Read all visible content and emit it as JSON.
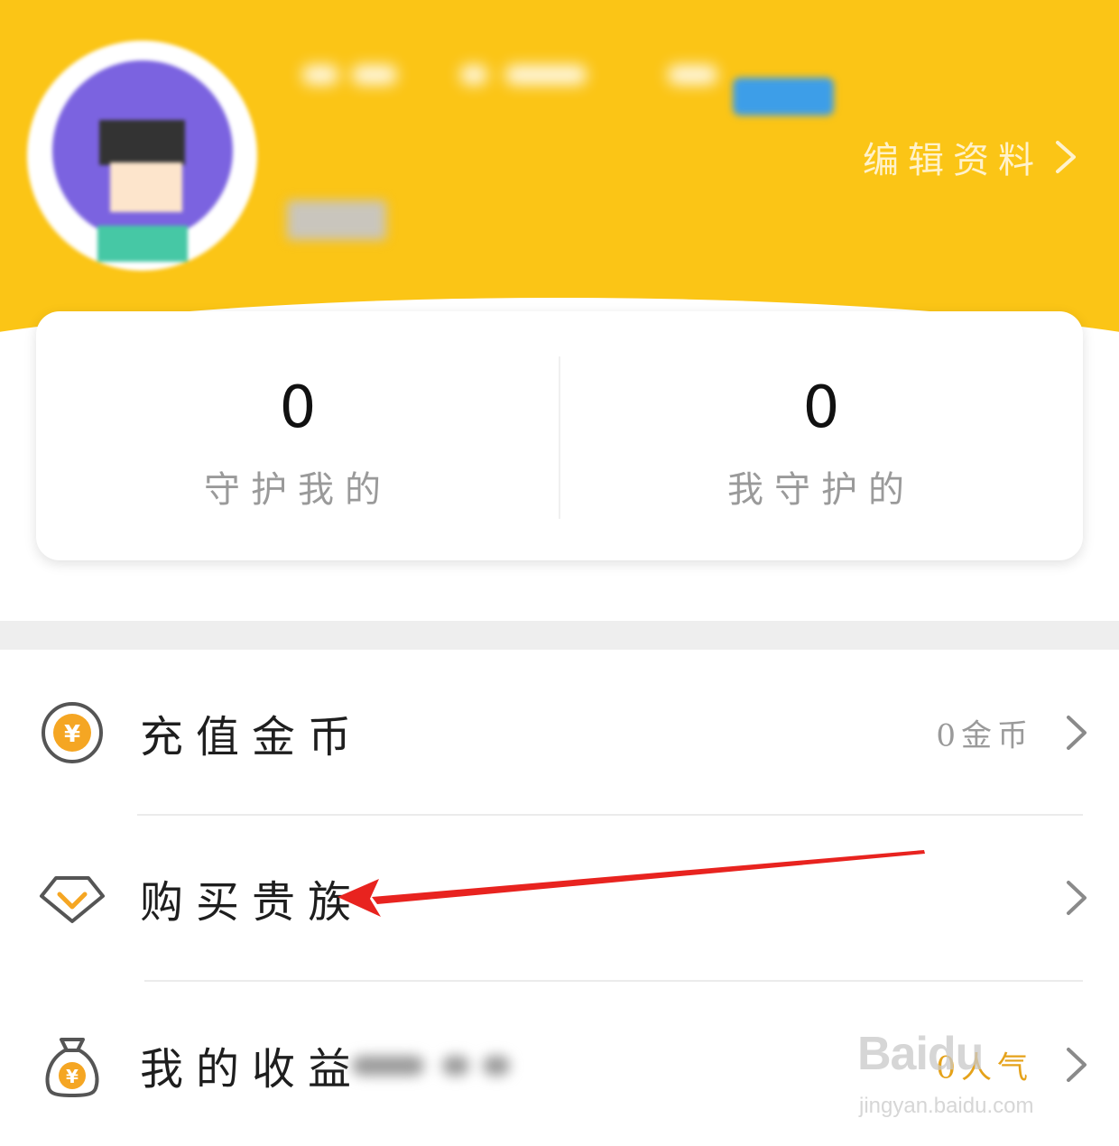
{
  "header": {
    "edit_profile_label": "编辑资料",
    "background_color": "#fbc516"
  },
  "guard_stats": [
    {
      "count": "0",
      "label": "守护我的"
    },
    {
      "count": "0",
      "label": "我守护的"
    }
  ],
  "menu": [
    {
      "icon": "yuan-coin-icon",
      "label": "充值金币",
      "value": "0金币",
      "accent": "#f5a623"
    },
    {
      "icon": "diamond-icon",
      "label": "购买贵族",
      "value": ""
    },
    {
      "icon": "money-bag-icon",
      "label": "我的收益",
      "value": "0人气"
    }
  ],
  "watermark": {
    "brand": "Baidu",
    "url": "jingyan.baidu.com"
  },
  "colors": {
    "accent_orange": "#f5a623",
    "arrow_red": "#e8231f"
  }
}
